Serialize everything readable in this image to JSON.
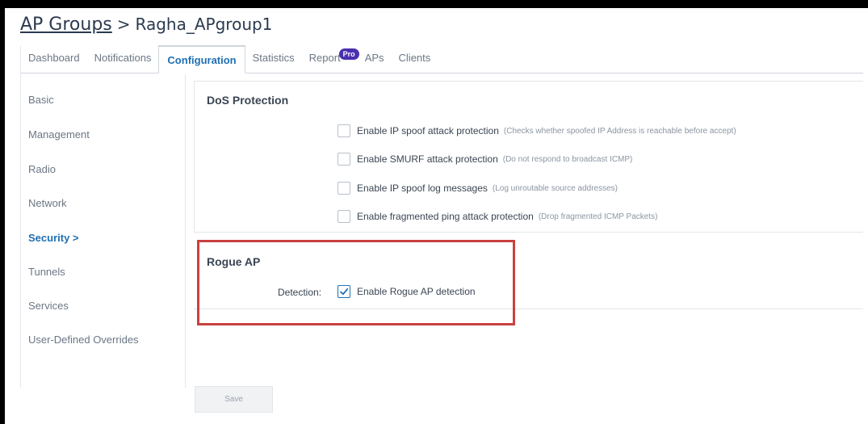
{
  "breadcrumb": {
    "parent_link": "AP Groups",
    "separator": ">",
    "current": "Ragha_APgroup1"
  },
  "tabs": [
    {
      "label": "Dashboard"
    },
    {
      "label": "Notifications"
    },
    {
      "label": "Configuration",
      "active": true
    },
    {
      "label": "Statistics"
    },
    {
      "label": "Report",
      "badge": "Pro"
    },
    {
      "label": "APs"
    },
    {
      "label": "Clients"
    }
  ],
  "sidebar": {
    "items": [
      {
        "label": "Basic"
      },
      {
        "label": "Management"
      },
      {
        "label": "Radio"
      },
      {
        "label": "Network"
      },
      {
        "label": "Security >",
        "active": true
      },
      {
        "label": "Tunnels"
      },
      {
        "label": "Services"
      },
      {
        "label": "User-Defined Overrides"
      }
    ]
  },
  "dos": {
    "title": "DoS Protection",
    "options": [
      {
        "label": "Enable IP spoof attack protection",
        "hint": "(Checks whether spoofed IP Address is reachable before accept)",
        "checked": false
      },
      {
        "label": "Enable SMURF attack protection",
        "hint": "(Do not respond to broadcast ICMP)",
        "checked": false
      },
      {
        "label": "Enable IP spoof log messages",
        "hint": "(Log unroutable source addresses)",
        "checked": false
      },
      {
        "label": "Enable fragmented ping attack protection",
        "hint": "(Drop fragmented ICMP Packets)",
        "checked": false
      }
    ]
  },
  "rogue": {
    "title": "Rogue AP",
    "detection_label": "Detection:",
    "option_label": "Enable Rogue AP detection",
    "checked": true
  },
  "actions": {
    "save_label": "Save"
  },
  "colors": {
    "accent": "#1f6fb2",
    "highlight_border": "#c9413f",
    "pro_badge": "#4a2fb0"
  }
}
